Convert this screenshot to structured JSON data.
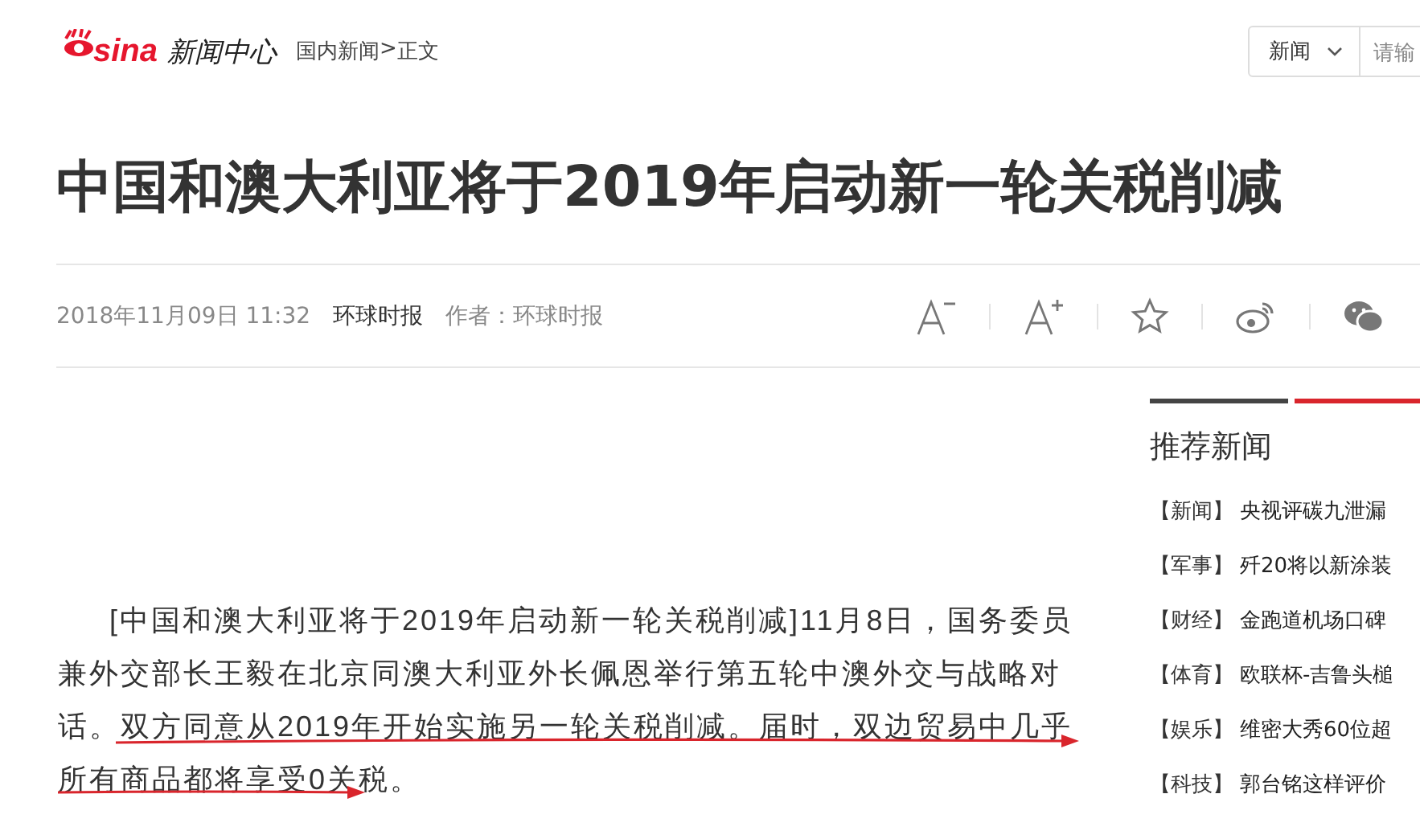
{
  "header": {
    "logo_text": "sina",
    "site_name": "新闻中心",
    "breadcrumb": [
      {
        "label": "国内新闻"
      },
      {
        "label": ">"
      },
      {
        "label": "正文"
      }
    ],
    "search": {
      "category": "新闻",
      "placeholder": "请输"
    }
  },
  "article": {
    "title": "中国和澳大利亚将于2019年启动新一轮关税削减",
    "date": "2018年11月09日 11:32",
    "source": "环球时报",
    "author": "作者：环球时报",
    "tools": [
      {
        "kind": "font-smaller"
      },
      {
        "kind": "font-larger"
      },
      {
        "kind": "favorite"
      },
      {
        "kind": "weibo"
      },
      {
        "kind": "wechat"
      }
    ],
    "paragraph": "[中国和澳大利亚将于2019年启动新一轮关税削减]11月8日，国务委员兼外交部长王毅在北京同澳大利亚外长佩恩举行第五轮中澳外交与战略对话。双方同意从2019年开始实施另一轮关税削减。届时，双边贸易中几乎所有商品都将享受0关税。"
  },
  "sidebar": {
    "heading": "推荐新闻",
    "items": [
      {
        "tag": "【新闻】",
        "title": "央视评碳九泄漏"
      },
      {
        "tag": "【军事】",
        "title": "歼20将以新涂装"
      },
      {
        "tag": "【财经】",
        "title": "金跑道机场口碑"
      },
      {
        "tag": "【体育】",
        "title": "欧联杯-吉鲁头槌"
      },
      {
        "tag": "【娱乐】",
        "title": "维密大秀60位超"
      },
      {
        "tag": "【科技】",
        "title": "郭台铭这样评价"
      }
    ]
  }
}
